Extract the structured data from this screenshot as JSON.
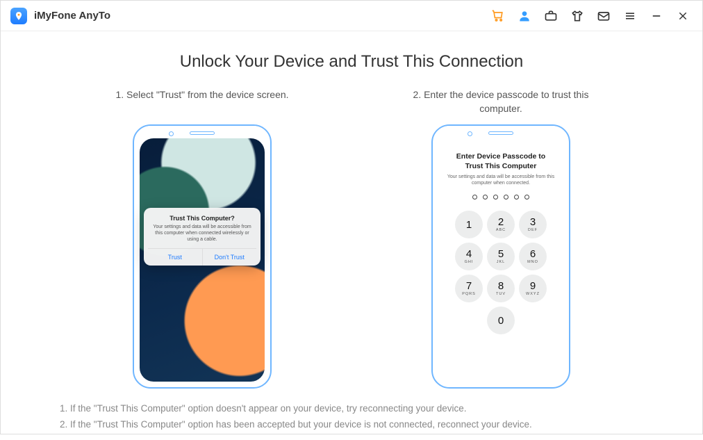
{
  "header": {
    "app_title": "iMyFone AnyTo"
  },
  "main": {
    "title": "Unlock Your Device and Trust This Connection",
    "step1_caption": "1. Select \"Trust\" from the device screen.",
    "step2_caption": "2. Enter the device passcode to trust this computer."
  },
  "trust_dialog": {
    "title": "Trust This Computer?",
    "desc": "Your settings and data will be accessible from this computer when connected wirelessly or using a cable.",
    "btn_trust": "Trust",
    "btn_dont": "Don't Trust"
  },
  "passcode": {
    "title": "Enter Device Passcode to Trust This Computer",
    "sub": "Your settings and data will be accessible from this computer when connected.",
    "keys": [
      {
        "n": "1",
        "l": ""
      },
      {
        "n": "2",
        "l": "ABC"
      },
      {
        "n": "3",
        "l": "DEF"
      },
      {
        "n": "4",
        "l": "GHI"
      },
      {
        "n": "5",
        "l": "JKL"
      },
      {
        "n": "6",
        "l": "MNO"
      },
      {
        "n": "7",
        "l": "PQRS"
      },
      {
        "n": "8",
        "l": "TUV"
      },
      {
        "n": "9",
        "l": "WXYZ"
      },
      {
        "n": "",
        "l": ""
      },
      {
        "n": "0",
        "l": ""
      },
      {
        "n": "",
        "l": ""
      }
    ]
  },
  "notes": {
    "n1": "1. If the \"Trust This Computer\" option doesn't appear on your device, try reconnecting your device.",
    "n2": "2. If the \"Trust This Computer\" option has been accepted but your device is not connected, reconnect your device."
  }
}
